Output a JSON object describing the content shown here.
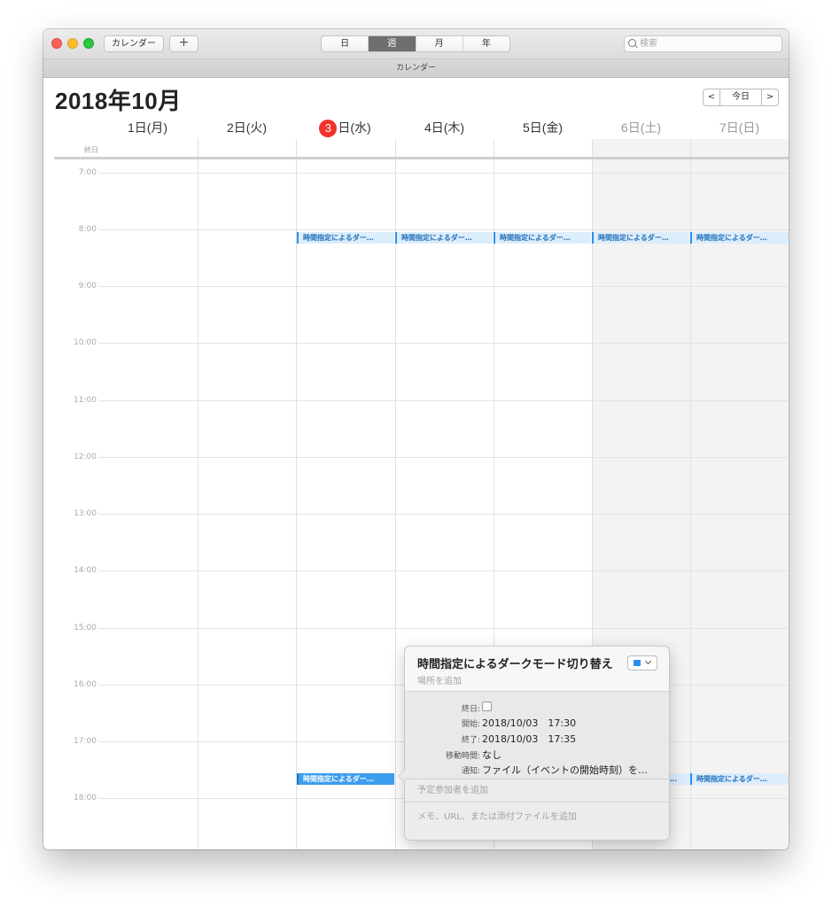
{
  "toolbar": {
    "calendars_label": "カレンダー",
    "add_label": "+",
    "views": [
      "日",
      "週",
      "月",
      "年"
    ],
    "active_view": "週",
    "search_placeholder": "検索"
  },
  "window_title": "カレンダー",
  "header": {
    "month_title": "2018年10月",
    "prev": "<",
    "today": "今日",
    "next": ">"
  },
  "days": [
    {
      "label": "1日(月)",
      "weekend": false,
      "today": false
    },
    {
      "label": "2日(火)",
      "weekend": false,
      "today": false
    },
    {
      "today_num": "3",
      "label": "日(水)",
      "weekend": false,
      "today": true
    },
    {
      "label": "4日(木)",
      "weekend": false,
      "today": false
    },
    {
      "label": "5日(金)",
      "weekend": false,
      "today": false
    },
    {
      "label": "6日(土)",
      "weekend": true,
      "today": false
    },
    {
      "label": "7日(日)",
      "weekend": true,
      "today": false
    }
  ],
  "allday_label": "終日",
  "hours": [
    "7:00",
    "8:00",
    "9:00",
    "10:00",
    "11:00",
    "12:00",
    "13:00",
    "14:00",
    "15:00",
    "16:00",
    "17:00",
    "18:00"
  ],
  "events": {
    "morning_label": "時間指定によるダー…",
    "evening_label": "時間指定によるダー…"
  },
  "popover": {
    "title": "時間指定によるダークモード切り替え",
    "location_placeholder": "場所を追加",
    "color": "#2b8ee8",
    "allday_label": "終日:",
    "start_label": "開始:",
    "start_value": "2018/10/03　17:30",
    "end_label": "終了:",
    "end_value": "2018/10/03　17:35",
    "travel_label": "移動時間:",
    "travel_value": "なし",
    "alert_label": "通知:",
    "alert_value": "ファイル（イベントの開始時刻）を…",
    "attendees_placeholder": "予定参加者を追加",
    "notes_placeholder": "メモ、URL、または添付ファイルを追加"
  },
  "colors": {
    "today_badge": "#f2332b",
    "event_accent": "#2d8ee8",
    "event_selected": "#3d9ef0"
  }
}
